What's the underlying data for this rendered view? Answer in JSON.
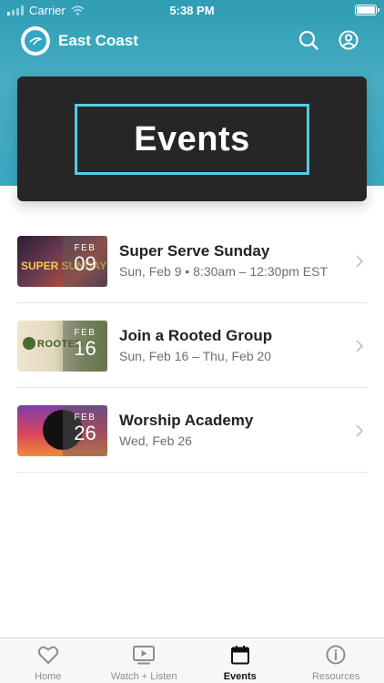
{
  "status_bar": {
    "carrier": "Carrier",
    "time": "5:38 PM"
  },
  "header": {
    "campus_name": "East Coast",
    "search_icon": "search-icon",
    "profile_icon": "user-circle-icon"
  },
  "banner": {
    "title": "Events",
    "accent_color": "#4dd0e8"
  },
  "events": [
    {
      "title": "Super Serve Sunday",
      "when": "Sun, Feb 9 • 8:30am – 12:30pm EST",
      "month": "FEB",
      "day": "09",
      "thumb_text": "SUPER SUNDAY"
    },
    {
      "title": "Join a Rooted Group",
      "when": "Sun, Feb 16 – Thu, Feb 20",
      "month": "FEB",
      "day": "16",
      "thumb_text": "ROOTED"
    },
    {
      "title": "Worship Academy",
      "when": "Wed, Feb 26",
      "month": "FEB",
      "day": "26",
      "thumb_text": ""
    }
  ],
  "tabs": [
    {
      "label": "Home",
      "icon": "heart-icon"
    },
    {
      "label": "Watch + Listen",
      "icon": "play-screen-icon"
    },
    {
      "label": "Events",
      "icon": "calendar-icon",
      "active": true
    },
    {
      "label": "Resources",
      "icon": "info-icon"
    }
  ],
  "colors": {
    "header_teal": "#3aa6bf",
    "banner_dark": "#262626",
    "accent": "#4dd0e8"
  }
}
